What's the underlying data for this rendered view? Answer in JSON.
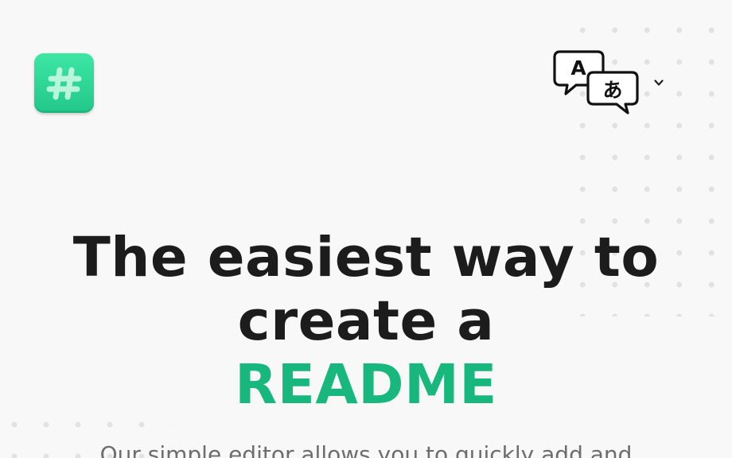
{
  "header": {
    "logo_icon": "hash-icon",
    "language_icon": "translate-icon",
    "language_letter_latin": "A",
    "language_letter_kana": "あ",
    "dropdown_icon": "chevron-down-icon"
  },
  "hero": {
    "title_line1": "The easiest way to",
    "title_line2": "create a",
    "title_accent": "README",
    "subtitle": "Our simple editor allows you to quickly add and"
  },
  "colors": {
    "accent": "#18b77e",
    "logo_gradient_top": "#3ee6a4",
    "logo_gradient_bottom": "#21c88a",
    "background": "#f8f8f8",
    "title_text": "#1c1c1c",
    "subtitle_text": "#6d6d6d"
  }
}
